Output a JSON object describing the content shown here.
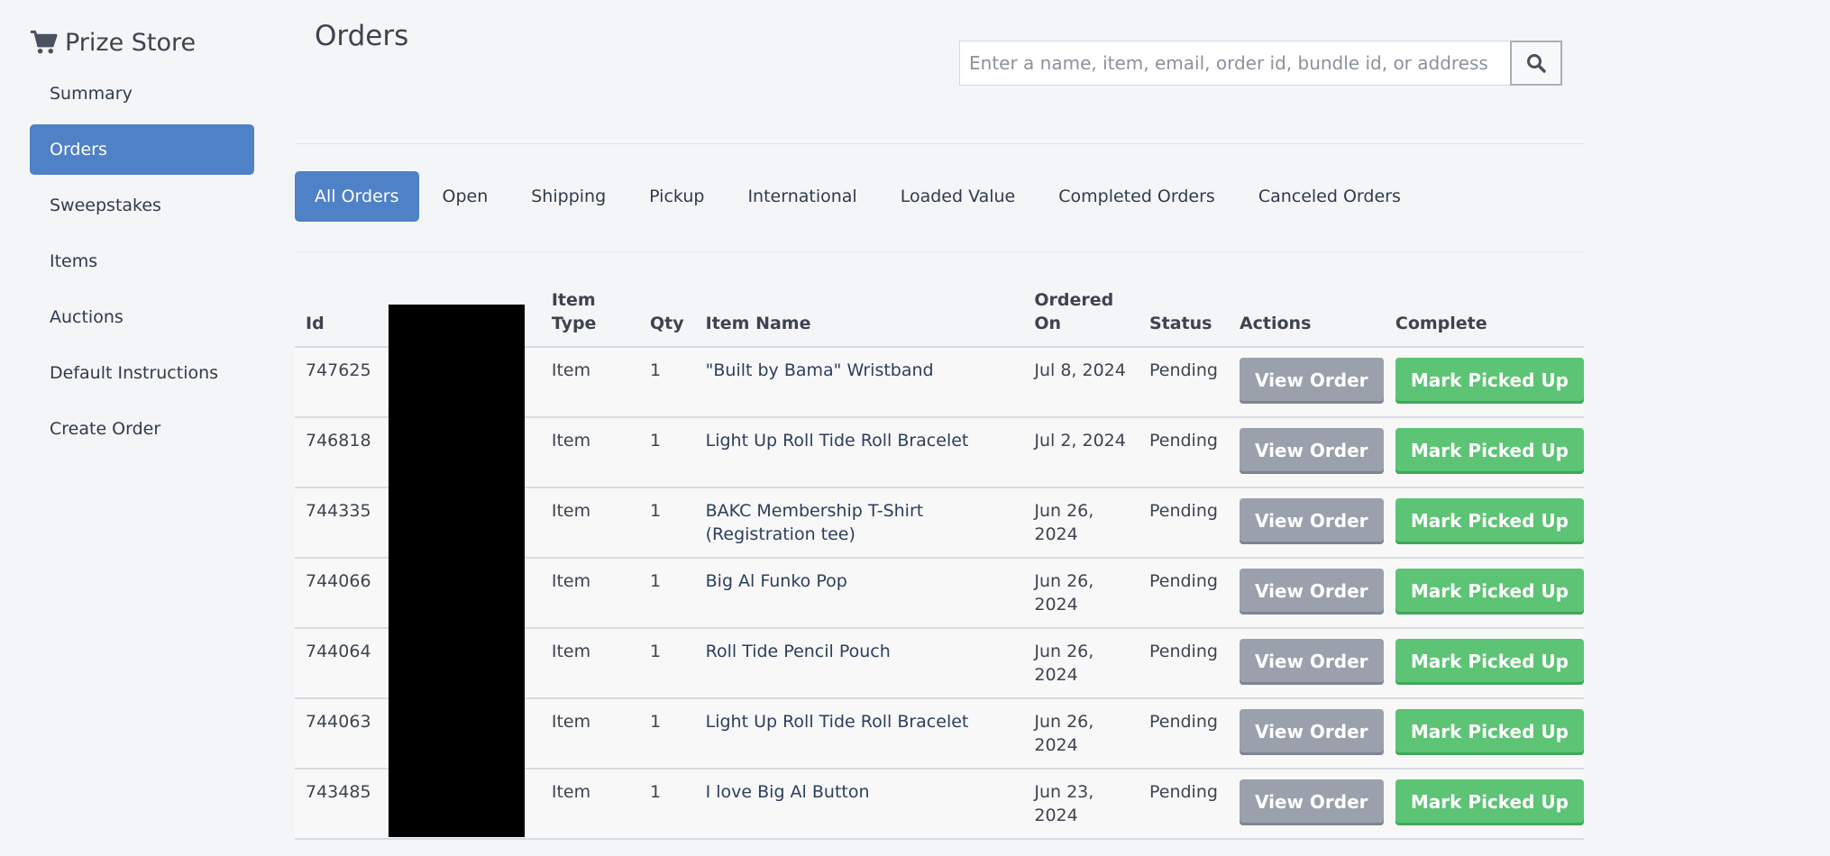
{
  "app": {
    "title": "Prize Store",
    "brand_icon": "shopping-cart-icon"
  },
  "sidebar": {
    "items": [
      {
        "label": "Summary",
        "active": false
      },
      {
        "label": "Orders",
        "active": true
      },
      {
        "label": "Sweepstakes",
        "active": false
      },
      {
        "label": "Items",
        "active": false
      },
      {
        "label": "Auctions",
        "active": false
      },
      {
        "label": "Default Instructions",
        "active": false
      },
      {
        "label": "Create Order",
        "active": false
      }
    ]
  },
  "page": {
    "title": "Orders"
  },
  "search": {
    "placeholder": "Enter a name, item, email, order id, bundle id, or address",
    "value": "",
    "button_icon": "search-icon"
  },
  "tabs": [
    {
      "label": "All Orders",
      "active": true
    },
    {
      "label": "Open",
      "active": false
    },
    {
      "label": "Shipping",
      "active": false
    },
    {
      "label": "Pickup",
      "active": false
    },
    {
      "label": "International",
      "active": false
    },
    {
      "label": "Loaded Value",
      "active": false
    },
    {
      "label": "Completed Orders",
      "active": false
    },
    {
      "label": "Canceled Orders",
      "active": false
    }
  ],
  "table": {
    "columns": {
      "id": "Id",
      "name": "",
      "item_type": "Item Type",
      "qty": "Qty",
      "item_name": "Item Name",
      "ordered_on": "Ordered On",
      "status": "Status",
      "actions": "Actions",
      "complete": "Complete"
    },
    "rows": [
      {
        "id": "747625",
        "item_type": "Item",
        "qty": "1",
        "item_name": "\"Built by Bama\" Wristband",
        "ordered_on": "Jul 8, 2024",
        "status": "Pending",
        "action_label": "View Order",
        "complete_label": "Mark Picked Up"
      },
      {
        "id": "746818",
        "item_type": "Item",
        "qty": "1",
        "item_name": "Light Up Roll Tide Roll Bracelet",
        "ordered_on": "Jul 2, 2024",
        "status": "Pending",
        "action_label": "View Order",
        "complete_label": "Mark Picked Up"
      },
      {
        "id": "744335",
        "item_type": "Item",
        "qty": "1",
        "item_name": "BAKC Membership T-Shirt (Registration tee)",
        "ordered_on": "Jun 26, 2024",
        "status": "Pending",
        "action_label": "View Order",
        "complete_label": "Mark Picked Up"
      },
      {
        "id": "744066",
        "item_type": "Item",
        "qty": "1",
        "item_name": "Big Al Funko Pop",
        "ordered_on": "Jun 26, 2024",
        "status": "Pending",
        "action_label": "View Order",
        "complete_label": "Mark Picked Up"
      },
      {
        "id": "744064",
        "item_type": "Item",
        "qty": "1",
        "item_name": "Roll Tide Pencil Pouch",
        "ordered_on": "Jun 26, 2024",
        "status": "Pending",
        "action_label": "View Order",
        "complete_label": "Mark Picked Up"
      },
      {
        "id": "744063",
        "item_type": "Item",
        "qty": "1",
        "item_name": "Light Up Roll Tide Roll Bracelet",
        "ordered_on": "Jun 26, 2024",
        "status": "Pending",
        "action_label": "View Order",
        "complete_label": "Mark Picked Up"
      },
      {
        "id": "743485",
        "item_type": "Item",
        "qty": "1",
        "item_name": "I love Big Al Button",
        "ordered_on": "Jun 23, 2024",
        "status": "Pending",
        "action_label": "View Order",
        "complete_label": "Mark Picked Up"
      }
    ]
  },
  "colors": {
    "accent": "#4f81c6",
    "success": "#5cc474",
    "neutral_button": "#9aa1ad",
    "background": "#f4f5f7"
  }
}
